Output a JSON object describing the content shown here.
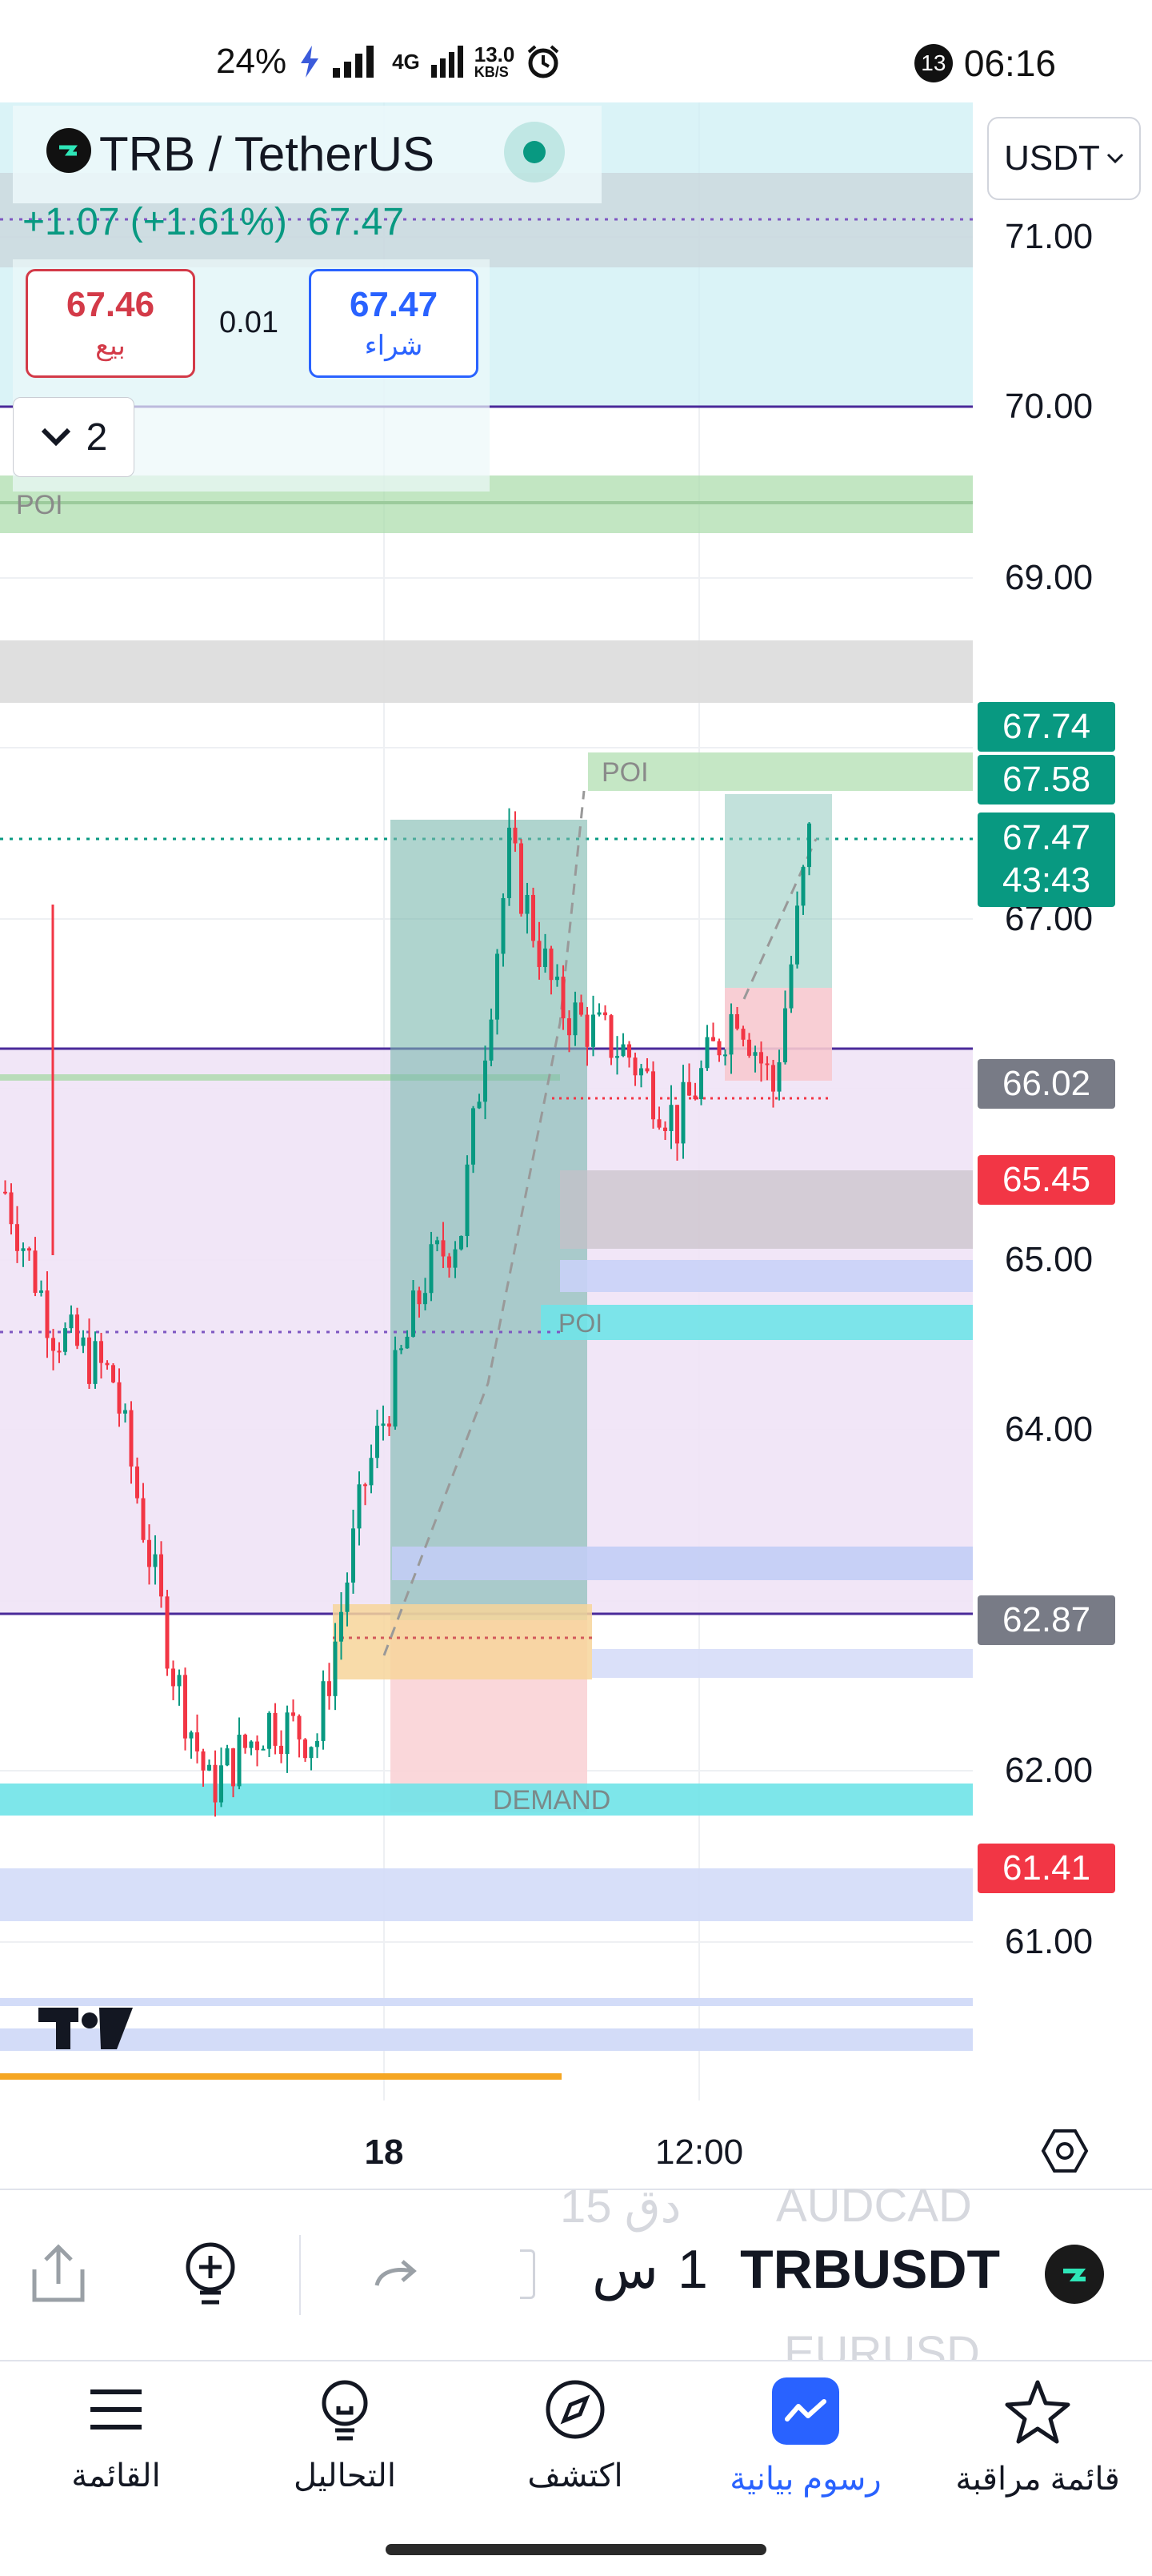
{
  "status_bar": {
    "battery": "24%",
    "network": "4G",
    "speed_value": "13.0",
    "speed_unit": "KB/S",
    "notification_count": "13",
    "time": "06:16"
  },
  "header": {
    "symbol_title": "TRB / TetherUS",
    "change": "+1.07 (+1.61%)",
    "last_price": "67.47",
    "sell_price": "67.46",
    "sell_label": "بيع",
    "buy_price": "67.47",
    "buy_label": "شراء",
    "spread": "0.01",
    "collapse_count": "2",
    "currency": "USDT"
  },
  "price_axis": {
    "labels": [
      "71.00",
      "70.00",
      "69.00",
      "67.00",
      "65.00",
      "64.00",
      "62.00",
      "61.00"
    ],
    "tags": [
      {
        "text": "67.74",
        "color": "#089981"
      },
      {
        "text": "67.58",
        "color": "#089981"
      },
      {
        "text": "67.47",
        "text2": "43:43",
        "color": "#089981"
      },
      {
        "text": "66.02",
        "color": "#787b86"
      },
      {
        "text": "65.45",
        "color": "#f23645"
      },
      {
        "text": "62.87",
        "color": "#787b86"
      },
      {
        "text": "61.41",
        "color": "#f23645"
      }
    ]
  },
  "chart_annotations": {
    "poi_1": "POI",
    "poi_2": "POI",
    "poi_3": "POI",
    "demand": "DEMAND"
  },
  "time_axis": {
    "labels": [
      "18",
      "12:00"
    ]
  },
  "toolbar": {
    "symbol": "TRBUSDT",
    "interval_value": "1",
    "interval_unit": "س",
    "ghost_above": "AUDCAD",
    "ghost_above_interval": "15 دق",
    "ghost_below": "EURUSD"
  },
  "nav": {
    "items": [
      {
        "label": "القائمة",
        "icon": "menu-icon"
      },
      {
        "label": "التحاليل",
        "icon": "ideas-icon"
      },
      {
        "label": "اكتشف",
        "icon": "compass-icon"
      },
      {
        "label": "رسوم بيانية",
        "icon": "chart-icon"
      },
      {
        "label": "قائمة مراقبة",
        "icon": "star-icon"
      }
    ],
    "active_index": 3
  },
  "colors": {
    "up": "#089981",
    "down": "#f23645",
    "accent": "#2962ff"
  }
}
